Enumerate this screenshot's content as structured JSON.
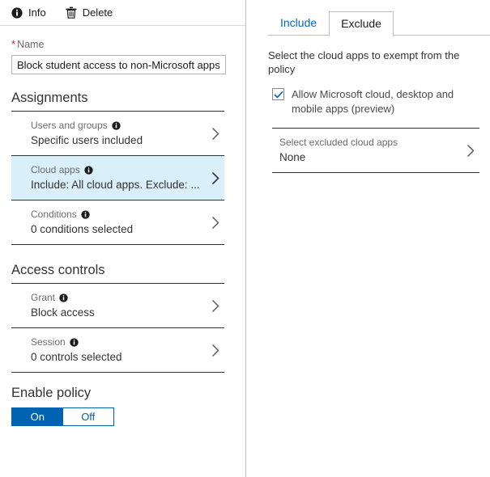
{
  "left_panel": {
    "command_bar": {
      "info_label": "Info",
      "info_icon": "info-circle-icon",
      "delete_label": "Delete",
      "delete_icon": "trash-icon"
    },
    "name_field": {
      "required_marker": "*",
      "label": "Name",
      "value": "Block student access to non-Microsoft apps"
    },
    "assignments": {
      "title": "Assignments",
      "rows": [
        {
          "label": "Users and groups",
          "value": "Specific users included",
          "selected": false
        },
        {
          "label": "Cloud apps",
          "value": "Include: All cloud apps. Exclude: ...",
          "selected": true
        },
        {
          "label": "Conditions",
          "value": "0 conditions selected",
          "selected": false
        }
      ]
    },
    "access_controls": {
      "title": "Access controls",
      "rows": [
        {
          "label": "Grant",
          "value": "Block access",
          "selected": false
        },
        {
          "label": "Session",
          "value": "0 controls selected",
          "selected": false
        }
      ]
    },
    "enable_policy": {
      "title": "Enable policy",
      "on_label": "On",
      "off_label": "Off",
      "selected": "On"
    }
  },
  "right_panel": {
    "tabs": [
      {
        "label": "Include",
        "active": false
      },
      {
        "label": "Exclude",
        "active": true
      }
    ],
    "description": "Select the cloud apps to exempt from the policy",
    "allow_microsoft": {
      "label": "Allow Microsoft cloud, desktop and mobile apps (preview)",
      "checked": true
    },
    "excluded_apps": {
      "label": "Select excluded cloud apps",
      "value": "None"
    }
  },
  "colors": {
    "accent_blue": "#0063b1",
    "link_blue": "#0066cc",
    "selected_row_bg": "#d9effa",
    "required_red": "#e81123",
    "rule_dark": "#333333",
    "rule_light": "#d8d8d8"
  }
}
